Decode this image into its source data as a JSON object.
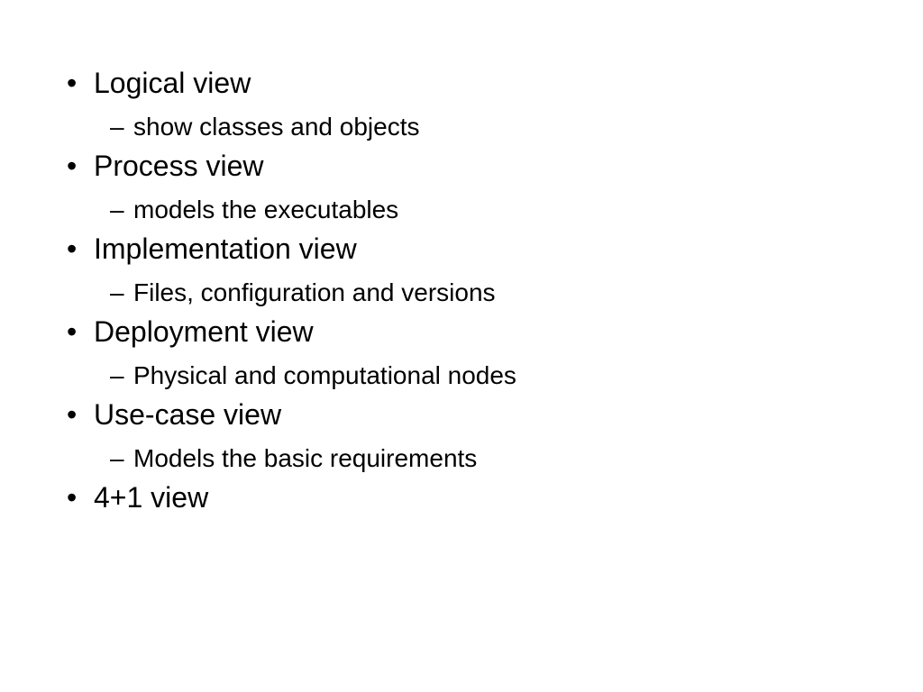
{
  "items": [
    {
      "title": "Logical view",
      "sub": "show classes and objects"
    },
    {
      "title": "Process view",
      "sub": "models the executables"
    },
    {
      "title": "Implementation view",
      "sub": "Files, configuration and versions"
    },
    {
      "title": "Deployment view",
      "sub": "Physical and computational nodes"
    },
    {
      "title": "Use-case view",
      "sub": "Models the basic requirements"
    },
    {
      "title": "4+1 view"
    }
  ]
}
